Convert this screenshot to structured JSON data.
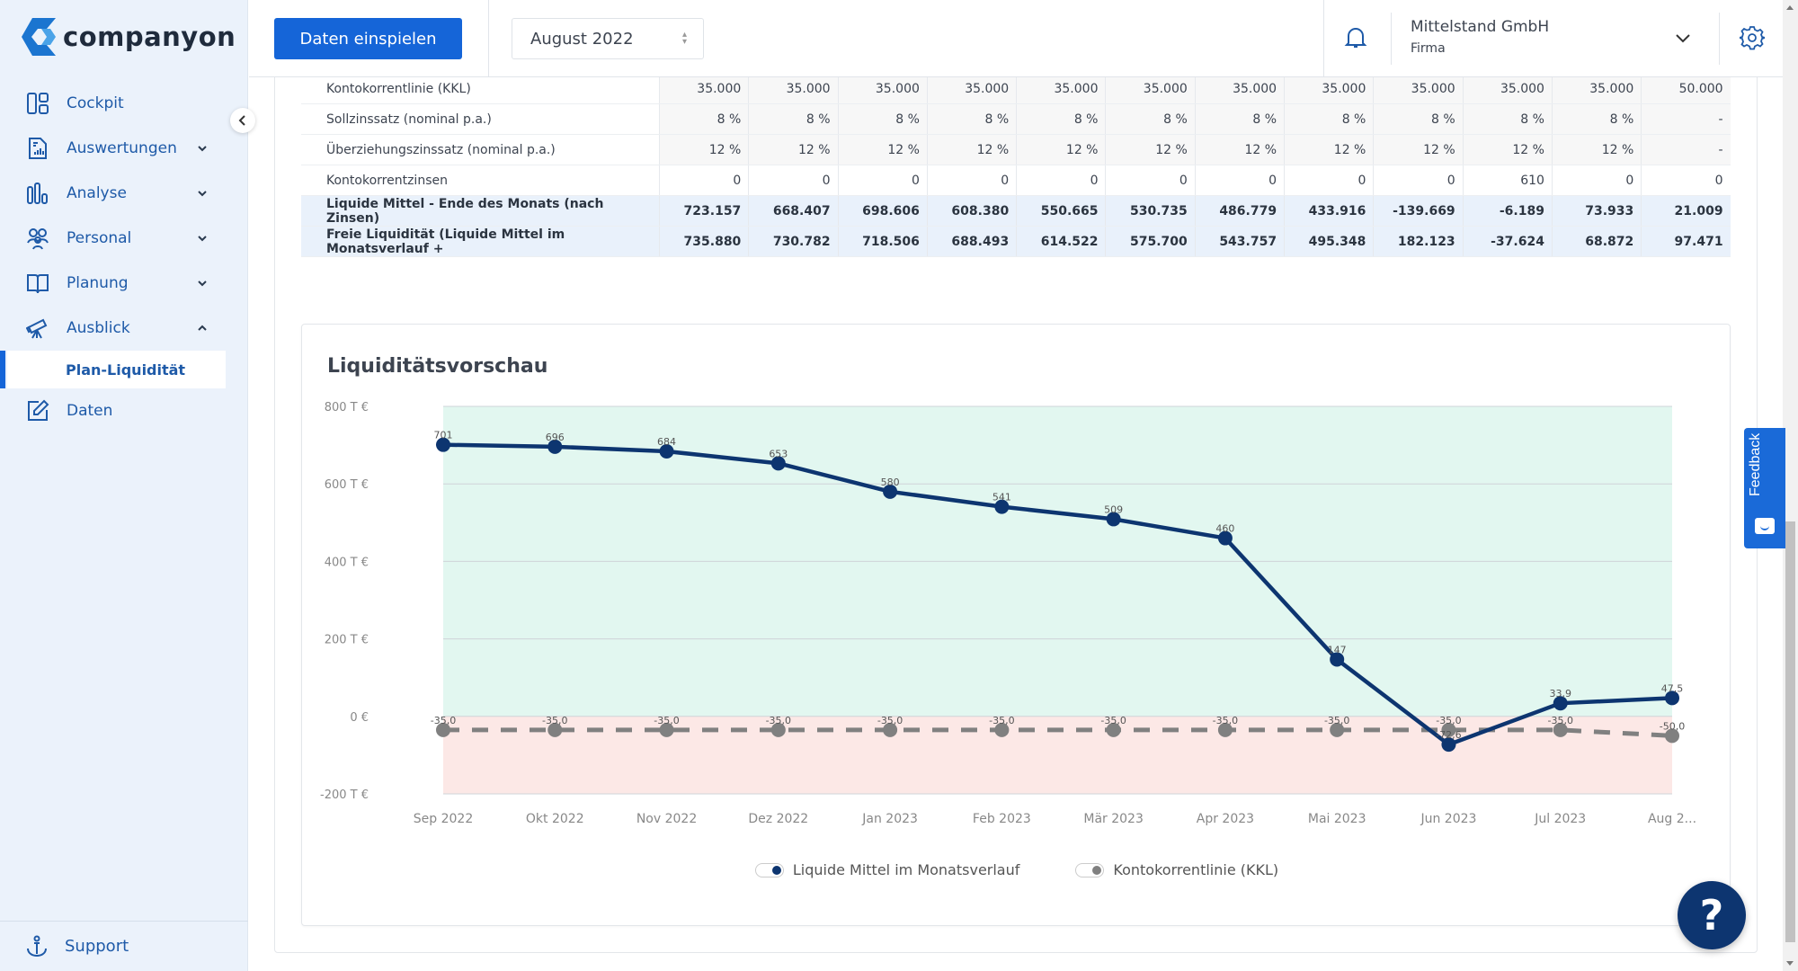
{
  "app": {
    "logo_text": "companyon",
    "brand_color": "#1565d8",
    "navy_color": "#0d3570"
  },
  "sidebar": {
    "items": [
      {
        "label": "Cockpit",
        "icon": "dashboard-icon",
        "expandable": false
      },
      {
        "label": "Auswertungen",
        "icon": "report-icon",
        "expandable": true,
        "expanded": false
      },
      {
        "label": "Analyse",
        "icon": "bar-chart-icon",
        "expandable": true,
        "expanded": false
      },
      {
        "label": "Personal",
        "icon": "people-icon",
        "expandable": true,
        "expanded": false
      },
      {
        "label": "Planung",
        "icon": "book-icon",
        "expandable": true,
        "expanded": false
      },
      {
        "label": "Ausblick",
        "icon": "telescope-icon",
        "expandable": true,
        "expanded": true
      },
      {
        "label": "Daten",
        "icon": "edit-icon",
        "expandable": false
      }
    ],
    "sub_item_active": "Plan-Liquidität",
    "support_label": "Support"
  },
  "topbar": {
    "import_button": "Daten einspielen",
    "month_select": "August 2022",
    "company_name": "Mittelstand GmbH",
    "company_role": "Firma"
  },
  "table": {
    "rows": [
      {
        "label": "Kontokorrentlinie (KKL)",
        "values": [
          "35.000",
          "35.000",
          "35.000",
          "35.000",
          "35.000",
          "35.000",
          "35.000",
          "35.000",
          "35.000",
          "35.000",
          "35.000",
          "50.000"
        ],
        "highlight": false
      },
      {
        "label": "Sollzinssatz (nominal p.a.)",
        "values": [
          "8 %",
          "8 %",
          "8 %",
          "8 %",
          "8 %",
          "8 %",
          "8 %",
          "8 %",
          "8 %",
          "8 %",
          "8 %",
          "-"
        ],
        "highlight": false
      },
      {
        "label": "Überziehungszinssatz (nominal p.a.)",
        "values": [
          "12 %",
          "12 %",
          "12 %",
          "12 %",
          "12 %",
          "12 %",
          "12 %",
          "12 %",
          "12 %",
          "12 %",
          "12 %",
          "-"
        ],
        "highlight": false
      },
      {
        "label": "Kontokorrentzinsen",
        "values": [
          "0",
          "0",
          "0",
          "0",
          "0",
          "0",
          "0",
          "0",
          "0",
          "610",
          "0",
          "0"
        ],
        "highlight": false,
        "white": true
      },
      {
        "label": "Liquide Mittel - Ende des Monats (nach Zinsen)",
        "values": [
          "723.157",
          "668.407",
          "698.606",
          "608.380",
          "550.665",
          "530.735",
          "486.779",
          "433.916",
          "-139.669",
          "-6.189",
          "73.933",
          "21.009"
        ],
        "highlight": true
      },
      {
        "label": "Freie Liquidität (Liquide Mittel im Monatsverlauf +",
        "values": [
          "735.880",
          "730.782",
          "718.506",
          "688.493",
          "614.522",
          "575.700",
          "543.757",
          "495.348",
          "182.123",
          "-37.624",
          "68.872",
          "97.471"
        ],
        "highlight": true
      }
    ]
  },
  "chart": {
    "title": "Liquiditätsvorschau"
  },
  "chart_data": {
    "type": "line",
    "title": "Liquiditätsvorschau",
    "xlabel": "",
    "ylabel": "",
    "categories": [
      "Sep 2022",
      "Okt 2022",
      "Nov 2022",
      "Dez 2022",
      "Jan 2023",
      "Feb 2023",
      "Mär 2023",
      "Apr 2023",
      "Mai 2023",
      "Jun 2023",
      "Jul 2023",
      "Aug 2..."
    ],
    "ylim": [
      -200,
      800
    ],
    "yticks": [
      800,
      600,
      400,
      200,
      0,
      -200
    ],
    "ytick_labels": [
      "800 T €",
      "600 T €",
      "400 T €",
      "200 T €",
      "0 €",
      "-200 T €"
    ],
    "grid": true,
    "background_bands": [
      {
        "from": 0,
        "to": 800,
        "color": "#e2f7f0",
        "meaning": "positive"
      },
      {
        "from": -200,
        "to": 0,
        "color": "#fce8e6",
        "meaning": "negative"
      }
    ],
    "series": [
      {
        "name": "Liquide Mittel im Monatsverlauf",
        "color": "#0d3570",
        "style": "solid",
        "values": [
          701,
          696,
          684,
          653,
          580,
          541,
          509,
          460,
          147,
          -72.6,
          33.9,
          47.5
        ],
        "labels": [
          "701",
          "696",
          "684",
          "653",
          "580",
          "541",
          "509",
          "460",
          "147",
          "-72,6",
          "33,9",
          "47,5"
        ]
      },
      {
        "name": "Kontokorrentlinie (KKL)",
        "color": "#808080",
        "style": "dashed",
        "values": [
          -35,
          -35,
          -35,
          -35,
          -35,
          -35,
          -35,
          -35,
          -35,
          -35,
          -35,
          -50
        ],
        "labels": [
          "-35,0",
          "-35,0",
          "-35,0",
          "-35,0",
          "-35,0",
          "-35,0",
          "-35,0",
          "-35,0",
          "-35,0",
          "-35,0",
          "-35,0",
          "-50,0"
        ]
      }
    ],
    "legend_position": "bottom-center"
  },
  "widgets": {
    "feedback_label": "Feedback",
    "help_label": "?"
  }
}
